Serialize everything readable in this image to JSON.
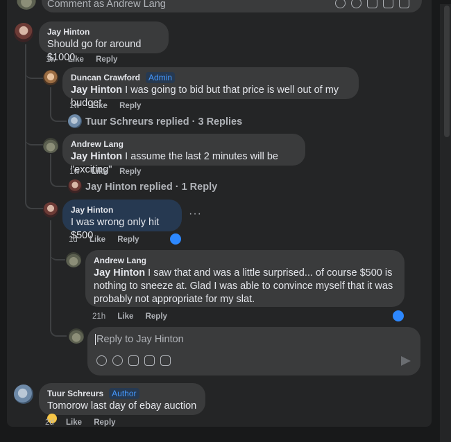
{
  "top_composer": {
    "placeholder": "Comment as Andrew Lang"
  },
  "comments": [
    {
      "author": "Jay Hinton",
      "text": "Should go for around $1000",
      "time": "1w",
      "like": "Like",
      "reply": "Reply"
    },
    {
      "author": "Duncan Crawford",
      "badge": "Admin",
      "mention": "Jay Hinton",
      "text": " I was going to bid but that price is well out of my budget",
      "time": "1w",
      "like": "Like",
      "reply": "Reply",
      "replies_summary": "Tuur Schreurs replied · 3 Replies"
    },
    {
      "author": "Andrew Lang",
      "mention": "Jay Hinton",
      "text": " I assume the last 2 minutes will be \"exciting\"",
      "time": "1w",
      "like": "Like",
      "reply": "Reply",
      "replies_summary": "Jay Hinton replied · 1 Reply"
    },
    {
      "author": "Jay Hinton",
      "text": "I was wrong only hit $500",
      "time": "1d",
      "like": "Like",
      "reply": "Reply",
      "more": "···"
    },
    {
      "author": "Andrew Lang",
      "mention": "Jay Hinton",
      "text": " I saw that and was a little surprised... of course $500 is nothing to sneeze at. Glad I was able to convince myself that it was probably not appropriate for my slat.",
      "time": "21h",
      "like": "Like",
      "reply": "Reply"
    },
    {
      "author": "Tuur Schreurs",
      "badge": "Author",
      "text": "Tomorow last day of ebay auction ",
      "time": "2d",
      "like": "Like",
      "reply": "Reply"
    }
  ],
  "reply_composer": {
    "placeholder": "Reply to Jay Hinton"
  },
  "colors": {
    "accent": "#2d88ff",
    "bubble": "#3a3b3c",
    "highlight": "#263951"
  }
}
